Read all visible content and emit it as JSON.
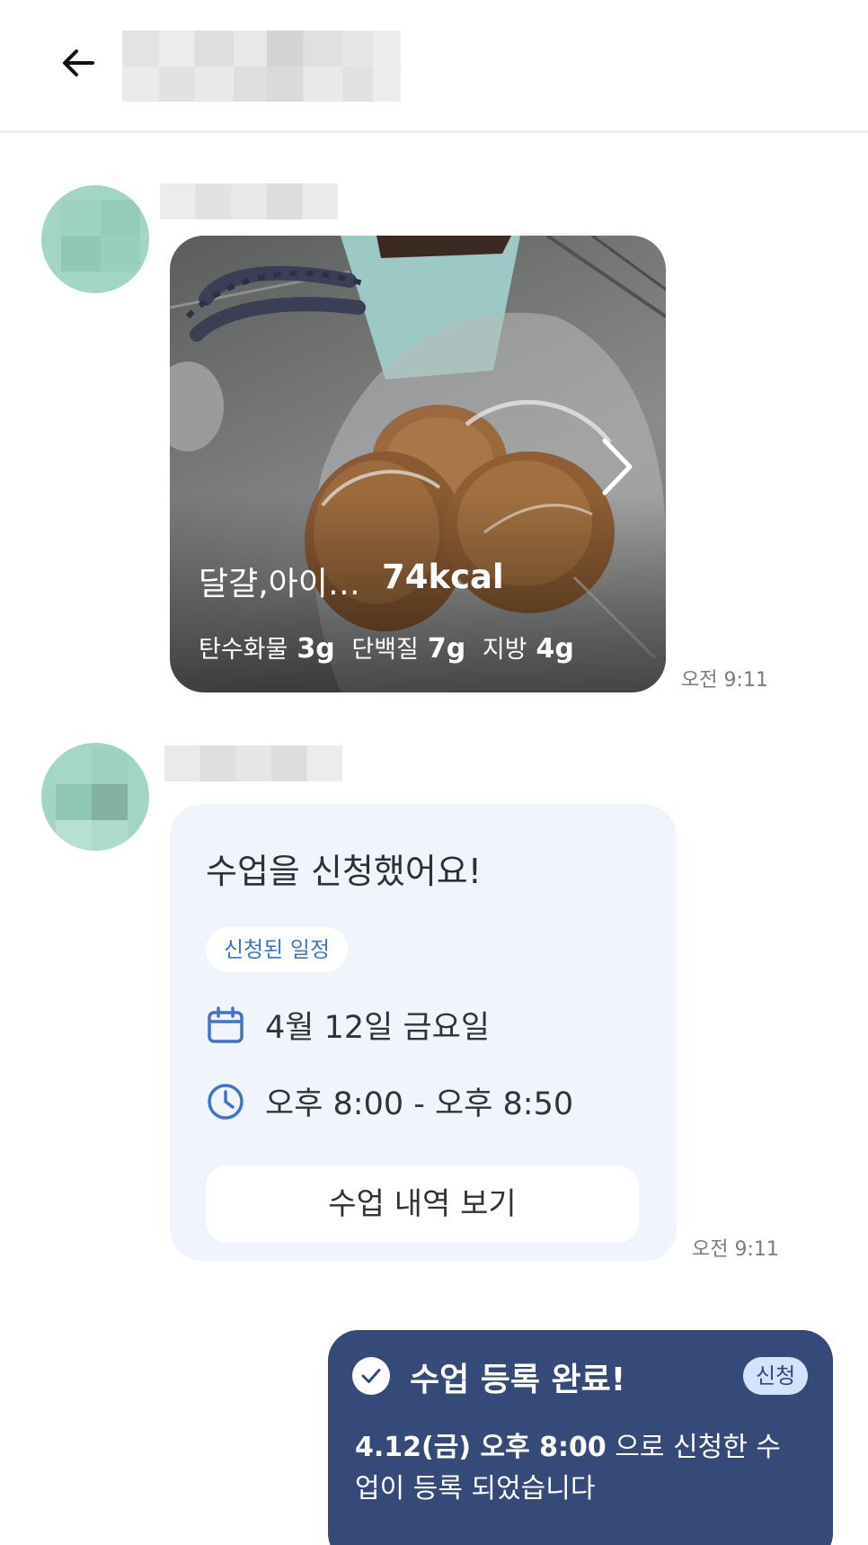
{
  "header": {
    "back_icon": "arrow-left-icon",
    "title": ""
  },
  "messages": [
    {
      "type": "food-photo",
      "food_name": "달걀,아이…",
      "kcal": "74kcal",
      "macros": {
        "carb_label": "탄수화물",
        "carb_value": "3g",
        "protein_label": "단백질",
        "protein_value": "7g",
        "fat_label": "지방",
        "fat_value": "4g"
      },
      "time": "오전 9:11"
    },
    {
      "type": "class-request",
      "title": "수업을 신청했어요!",
      "tag": "신청된 일정",
      "date": "4월 12일 금요일",
      "time_range": "오후 8:00 - 오후 8:50",
      "button_label": "수업 내역 보기",
      "time": "오전 9:11"
    },
    {
      "type": "registration-complete",
      "title": "수업 등록 완료!",
      "badge": "신청",
      "body_bold": "4.12(금) 오후 8:00",
      "body_rest": " 으로 신청한 수업이 등록 되었습니다"
    }
  ],
  "colors": {
    "accent_blue": "#3f74c9",
    "dark_card": "#354a78",
    "light_card": "#eff4fd",
    "avatar": "#a2d5c3"
  }
}
